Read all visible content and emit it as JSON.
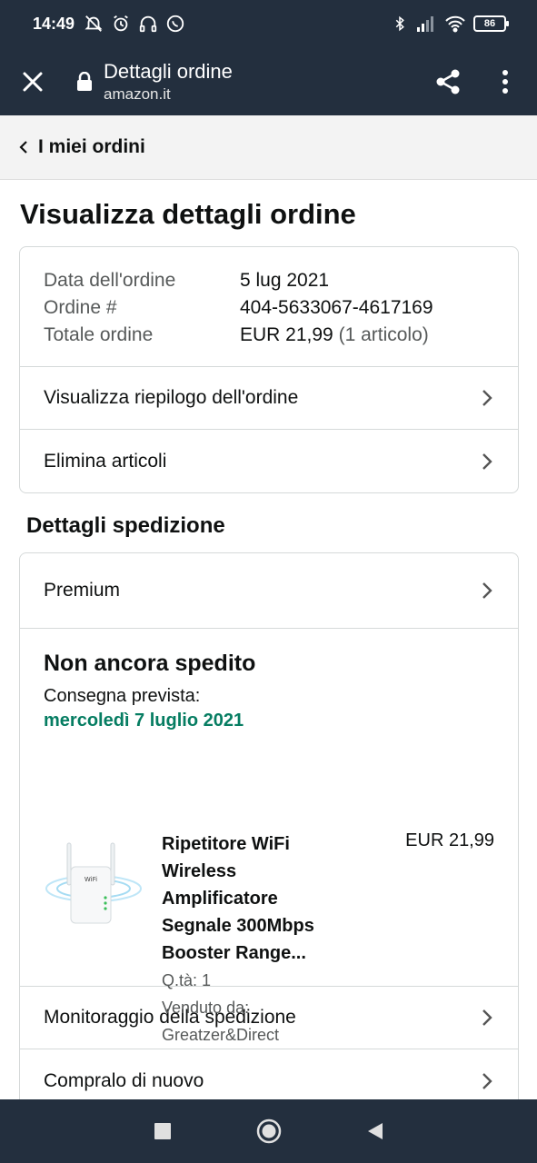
{
  "status_bar": {
    "time": "14:49",
    "battery": "86"
  },
  "browser": {
    "title": "Dettagli ordine",
    "domain": "amazon.it"
  },
  "back_link": {
    "label": "I miei ordini"
  },
  "page_title": "Visualizza dettagli ordine",
  "order_info": {
    "date_label": "Data dell'ordine",
    "date_value": "5 lug 2021",
    "number_label": "Ordine #",
    "number_value": "404-5633067-4617169",
    "total_label": "Totale ordine",
    "total_value": "EUR 21,99",
    "total_items": "(1 articolo)"
  },
  "order_links": {
    "summary": "Visualizza riepilogo dell'ordine",
    "delete": "Elimina articoli"
  },
  "shipping": {
    "section_title": "Dettagli spedizione",
    "method": "Premium",
    "status": "Non ancora spedito",
    "delivery_label": "Consegna prevista:",
    "delivery_date": "mercoledì 7 luglio 2021",
    "product": {
      "name_lines": [
        "Ripetitore WiFi",
        "Wireless",
        "Amplificatore",
        "Segnale 300Mbps",
        "Booster Range..."
      ],
      "price": "EUR 21,99",
      "quantity": "Q.tà: 1",
      "seller": "Venduto da: Greatzer&Direct"
    },
    "tracking": "Monitoraggio della spedizione",
    "buy_again": "Compralo di nuovo"
  },
  "colors": {
    "header": "#232f3e",
    "delivery_green": "#067d62"
  }
}
